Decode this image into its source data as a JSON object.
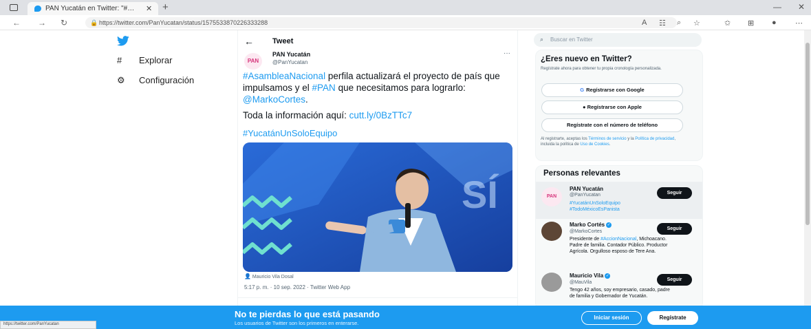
{
  "browser": {
    "tab_title": "PAN Yucatán en Twitter: \"#Asamb",
    "url": "https://twitter.com/PanYucatan/status/1575533870226333288",
    "status_url": "https://twitter.com/PanYucatan"
  },
  "nav": {
    "items": [
      {
        "label": "Explorar",
        "icon": "hashtag-icon"
      },
      {
        "label": "Configuración",
        "icon": "gear-icon"
      }
    ]
  },
  "tweet_header": {
    "title": "Tweet"
  },
  "tweet": {
    "author_name": "PAN Yucatán",
    "author_handle": "@PanYucatan",
    "avatar_text": "PAN",
    "text_hashtag1": "#AsambleaNacional",
    "text_part1": " perfila actualizará el proyecto de país que impulsamos y el ",
    "text_hashtag2": "#PAN",
    "text_part2": " que necesitamos para lograrlo: ",
    "text_mention": "@MarkoCortes",
    "text_period": ".",
    "line2_prefix": "Toda la información aquí: ",
    "line2_link": "cutt.ly/0BzTTc7",
    "line3_hashtag": "#YucatánUnSoloEquipo",
    "photo_tag": "Mauricio Vila Dosal",
    "meta": "5:17 p. m. · 10 sep. 2022 · Twitter Web App"
  },
  "sidebar": {
    "search_placeholder": "Buscar en Twitter",
    "new_title": "¿Eres nuevo en Twitter?",
    "new_desc": "Regístrate ahora para obtener tu propia cronología personalizada.",
    "google_label": "Regístrarse con Google",
    "apple_label": "Regístrarse con Apple",
    "phone_label": "Regístrate con el número de teléfono",
    "legal_prefix": "Al registrarte, aceptas los ",
    "legal_terms": "Términos de servicio",
    "legal_mid": " y la ",
    "legal_privacy": "Política de privacidad",
    "legal_mid2": ", incluida la política de ",
    "legal_cookies": "Uso de Cookies",
    "legal_end": ".",
    "relevant_title": "Personas relevantes",
    "people": [
      {
        "name": "PAN Yucatán",
        "handle": "@PanYucatan",
        "bio_line1": "#YucatánUnSoloEquipo",
        "bio_line2": "#TodoMéxicoEsPanista",
        "follow_label": "Seguir",
        "verified": false
      },
      {
        "name": "Marko Cortés",
        "handle": "@MarkoCortes",
        "bio_mention": "#AccionNacional",
        "bio_line1_prefix": "Presidente de ",
        "bio_rest": ", Michoacano. Padre de familia. Contador Público. Productor Agrícola. Orgulloso esposo de Tere Ana.",
        "follow_label": "Seguir",
        "verified": true
      },
      {
        "name": "Mauricio Vila",
        "handle": "@MauVila",
        "bio": "Tengo 42 años, soy empresario, casado, padre de familia y Gobernador de Yucatán.",
        "follow_label": "Seguir",
        "verified": true
      }
    ]
  },
  "banner": {
    "title": "No te pierdas lo que está pasando",
    "subtitle": "Los usuarios de Twitter son los primeros en enterarse.",
    "login_label": "Iniciar sesión",
    "signup_label": "Regístrate"
  },
  "colors": {
    "twitter_blue": "#1d9bf0",
    "text": "#0f1419",
    "muted": "#536471"
  }
}
